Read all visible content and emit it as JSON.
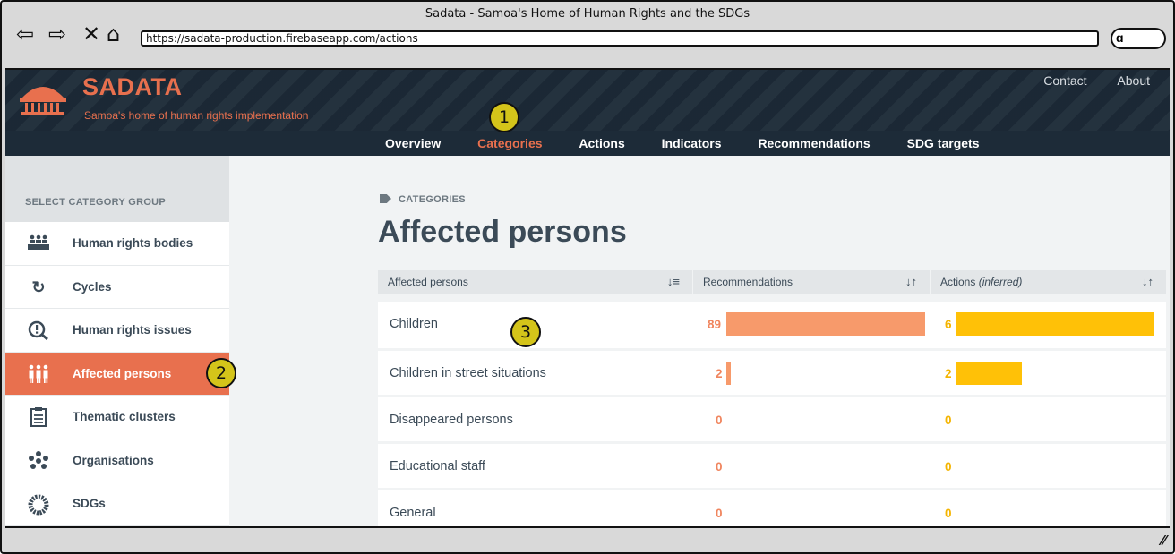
{
  "window": {
    "title": "Sadata - Samoa's Home of Human Rights and the SDGs",
    "url": "https://sadata-production.firebaseapp.com/actions"
  },
  "header": {
    "brand": "SADATA",
    "tagline": "Samoa's home of human rights implementation",
    "top_links": [
      "Contact",
      "About"
    ],
    "menu": [
      "Overview",
      "Categories",
      "Actions",
      "Indicators",
      "Recommendations",
      "SDG targets"
    ],
    "active_menu": "Categories"
  },
  "annotations": [
    "1",
    "2",
    "3"
  ],
  "sidebar": {
    "heading": "SELECT CATEGORY GROUP",
    "items": [
      {
        "label": "Human rights bodies",
        "icon": "assembly-icon"
      },
      {
        "label": "Cycles",
        "icon": "cycle-icon"
      },
      {
        "label": "Human rights issues",
        "icon": "magnify-exclamation-icon"
      },
      {
        "label": "Affected persons",
        "icon": "people-icon"
      },
      {
        "label": "Thematic clusters",
        "icon": "clipboard-list-icon"
      },
      {
        "label": "Organisations",
        "icon": "org-dots-icon"
      },
      {
        "label": "SDGs",
        "icon": "sdg-wheel-icon"
      }
    ],
    "active_index": 3
  },
  "main": {
    "breadcrumb": "CATEGORIES",
    "title": "Affected persons",
    "columns": {
      "name": "Affected persons",
      "recommendations": "Recommendations",
      "actions": "Actions",
      "actions_suffix": "(inferred)"
    },
    "rows": [
      {
        "name": "Children",
        "recommendations": "89",
        "actions": "6"
      },
      {
        "name": "Children in street situations",
        "recommendations": "2",
        "actions": "2"
      },
      {
        "name": "Disappeared persons",
        "recommendations": "0",
        "actions": "0"
      },
      {
        "name": "Educational staff",
        "recommendations": "0",
        "actions": "0"
      },
      {
        "name": "General",
        "recommendations": "0",
        "actions": "0"
      }
    ],
    "rec_max": 89,
    "act_max": 6
  },
  "colors": {
    "accent": "#e8704e",
    "rec_bar": "#f79a6b",
    "act_bar": "#ffc107",
    "header_bg": "#1d2b38",
    "badge": "#d4c41a"
  }
}
